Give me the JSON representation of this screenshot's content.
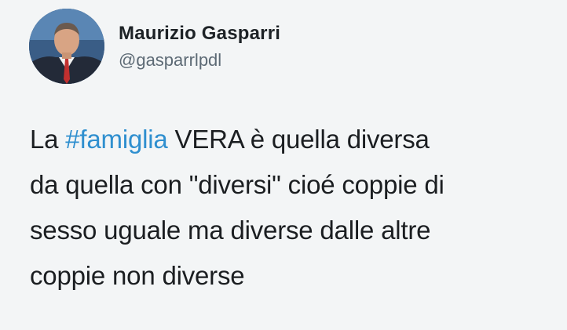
{
  "author": {
    "name": "Maurizio Gasparri",
    "handle": "@gasparrlpdl",
    "avatar_icon": "profile-photo"
  },
  "tweet": {
    "line1_before": "La ",
    "hashtag": "#famiglia",
    "line1_after": " VERA è quella diversa",
    "line2": "da quella con \"diversi\" cioé coppie di",
    "line3": "sesso uguale ma diverse dalle altre",
    "line4": "coppie non diverse"
  },
  "colors": {
    "hashtag": "#2f8fcf",
    "text": "#1b1e21",
    "handle": "#5d6a75",
    "background": "#f3f5f6"
  }
}
